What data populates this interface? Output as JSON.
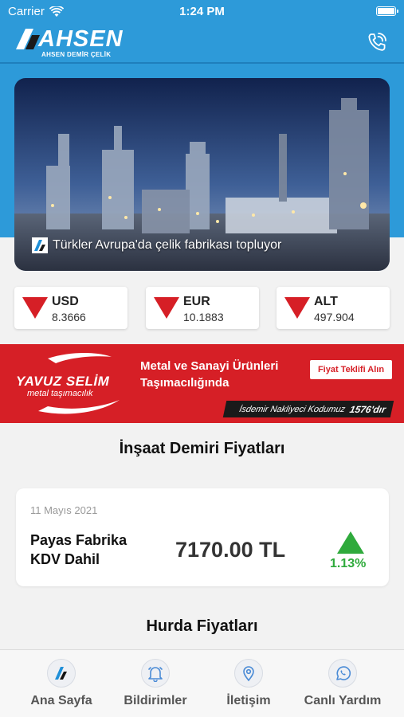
{
  "status_bar": {
    "carrier": "Carrier",
    "time": "1:24 PM"
  },
  "header": {
    "logo_text": "AHSEN",
    "logo_subtitle": "AHSEN DEMİR ÇELİK",
    "call_icon": "phone-call-icon"
  },
  "banner": {
    "caption": "Türkler Avrupa'da çelik fabrikası topluyor"
  },
  "rates": [
    {
      "code": "USD",
      "value": "8.3666",
      "trend": "down"
    },
    {
      "code": "EUR",
      "value": "10.1883",
      "trend": "down"
    },
    {
      "code": "ALT",
      "value": "497.904",
      "trend": "down"
    }
  ],
  "ad": {
    "brand": "YAVUZ SELİM",
    "brand_sub": "metal taşımacılık",
    "headline": "Metal ve Sanayi Ürünleri Taşımacılığında",
    "cta": "Fiyat Teklifi Alın",
    "code_text": "İsdemir Nakliyeci Kodumuz",
    "code_value": "1576'dır"
  },
  "rebar": {
    "title": "İnşaat Demiri Fiyatları",
    "date": "11 Mayıs 2021",
    "label": "Payas Fabrika KDV Dahil",
    "price": "7170.00 TL",
    "change": "1.13%",
    "trend": "up"
  },
  "scrap": {
    "title": "Hurda Fiyatları"
  },
  "tabs": [
    {
      "label": "Ana Sayfa",
      "icon": "home-logo-icon"
    },
    {
      "label": "Bildirimler",
      "icon": "bell-icon"
    },
    {
      "label": "İletişim",
      "icon": "location-pin-icon"
    },
    {
      "label": "Canlı Yardım",
      "icon": "whatsapp-icon"
    }
  ],
  "colors": {
    "header_blue": "#2d9ad9",
    "down_red": "#d61f26",
    "up_green": "#2faa3c"
  }
}
